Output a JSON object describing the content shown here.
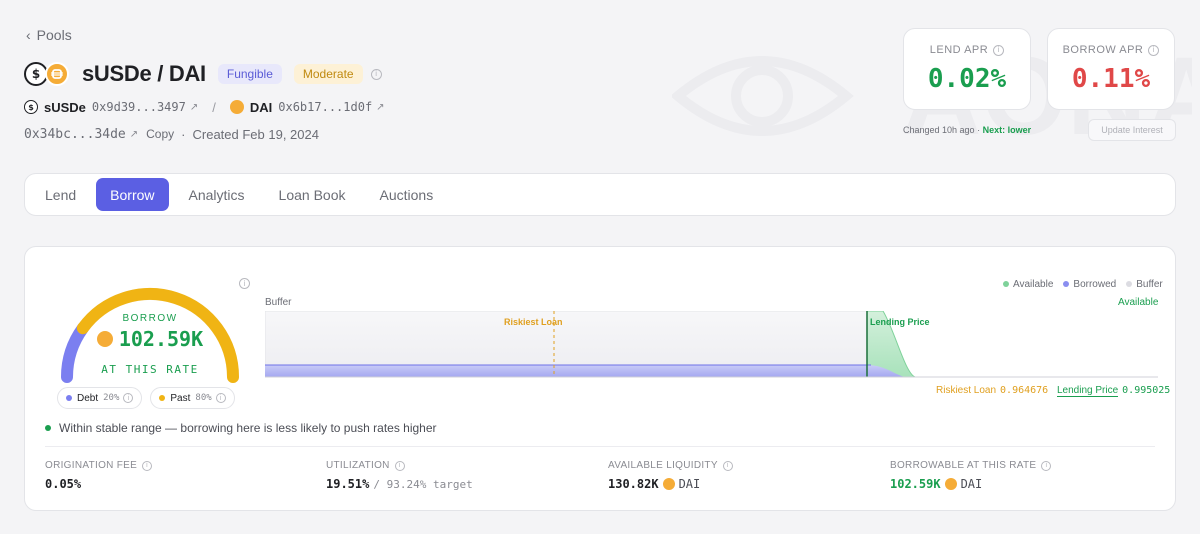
{
  "nav": {
    "back_label": "Pools"
  },
  "pool": {
    "title": "sUSDe / DAI",
    "badge_type": "Fungible",
    "badge_risk": "Moderate",
    "token_a": {
      "symbol": "sUSDe",
      "address": "0x9d39...3497"
    },
    "token_b": {
      "symbol": "DAI",
      "address": "0x6b17...1d0f"
    },
    "pool_address": "0x34bc...34de",
    "copy_label": "Copy",
    "created": "Created Feb 19, 2024"
  },
  "rates": {
    "lend_label": "LEND APR",
    "lend_value": "0.02%",
    "borrow_label": "BORROW APR",
    "borrow_value": "0.11%",
    "changed_text": "Changed 10h ago",
    "next_text": "Next: lower",
    "update_label": "Update Interest"
  },
  "tabs": [
    "Lend",
    "Borrow",
    "Analytics",
    "Loan Book",
    "Auctions"
  ],
  "active_tab": "Borrow",
  "gauge": {
    "top_label": "BORROW",
    "value": "102.59K",
    "bottom_label": "AT THIS RATE",
    "fill_fraction": 0.8,
    "chip_debt_label": "Debt",
    "chip_debt_pct": "20%",
    "chip_past_label": "Past",
    "chip_past_pct": "80%"
  },
  "chart": {
    "legend_available": "Available",
    "legend_borrowed": "Borrowed",
    "legend_buffer": "Buffer",
    "buffer_label": "Buffer",
    "available_label": "Available",
    "riskiest_marker_label": "Riskiest Loan",
    "lending_marker_label": "Lending Price",
    "riskiest_axis_label": "Riskiest Loan",
    "riskiest_axis_value": "0.964676",
    "lending_axis_label": "Lending Price",
    "lending_axis_value": "0.995025"
  },
  "status_text": "Within stable range — borrowing here is less likely to push rates higher",
  "stats": {
    "origination_label": "ORIGINATION FEE",
    "origination_value": "0.05%",
    "utilization_label": "UTILIZATION",
    "utilization_value": "19.51%",
    "utilization_target": "/ 93.24% target",
    "liquidity_label": "AVAILABLE LIQUIDITY",
    "liquidity_value": "130.82K",
    "liquidity_unit": "DAI",
    "borrowable_label": "BORROWABLE AT THIS RATE",
    "borrowable_value": "102.59K",
    "borrowable_unit": "DAI"
  },
  "colors": {
    "accent": "#5b5fe3",
    "green": "#1a9e4f",
    "red": "#e04848",
    "gauge_fill": "#f0b414",
    "gauge_debt": "#7b7ff0"
  }
}
